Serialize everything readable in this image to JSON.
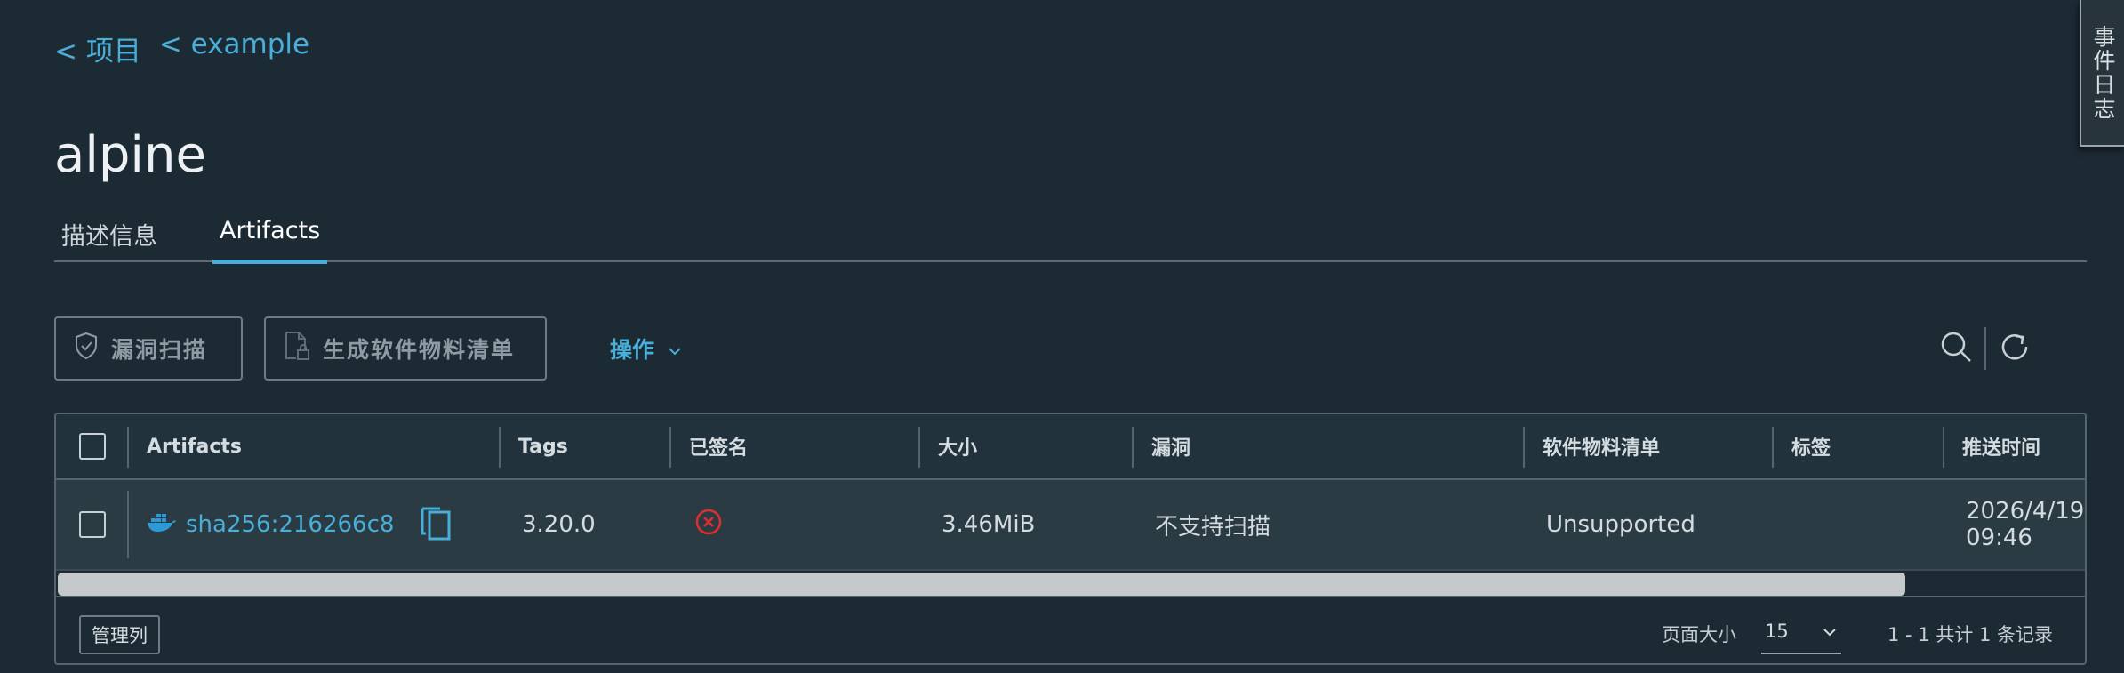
{
  "breadcrumbs": {
    "projects": "< 项目",
    "project": "< example"
  },
  "repo_name": "alpine",
  "tabs": {
    "info": "描述信息",
    "artifacts": "Artifacts"
  },
  "event_log": "事件日志",
  "toolbar": {
    "scan_label": "漏洞扫描",
    "sbom_label": "生成软件物料清单",
    "actions_label": "操作"
  },
  "table": {
    "headers": {
      "artifacts": "Artifacts",
      "tags": "Tags",
      "signed": "已签名",
      "size": "大小",
      "vulnerabilities": "漏洞",
      "sbom": "软件物料清单",
      "labels": "标签",
      "push_time": "推送时间"
    },
    "rows": [
      {
        "digest": "sha256:216266c8",
        "tags": "3.20.0",
        "signed_icon": "circle-x-icon",
        "size": "3.46MiB",
        "vulnerabilities": "不支持扫描",
        "sbom": "Unsupported",
        "labels": "",
        "push_date": "2026/4/19",
        "push_time": "09:46"
      }
    ]
  },
  "footer": {
    "manage_columns": "管理列",
    "page_size_label": "页面大小",
    "page_size_value": "15",
    "pagination": "1 - 1 共计 1 条记录"
  },
  "colors": {
    "background": "#1c2a33",
    "accent": "#49afd9",
    "error": "#e02e2e",
    "docker_blue": "#2c9ad6"
  }
}
